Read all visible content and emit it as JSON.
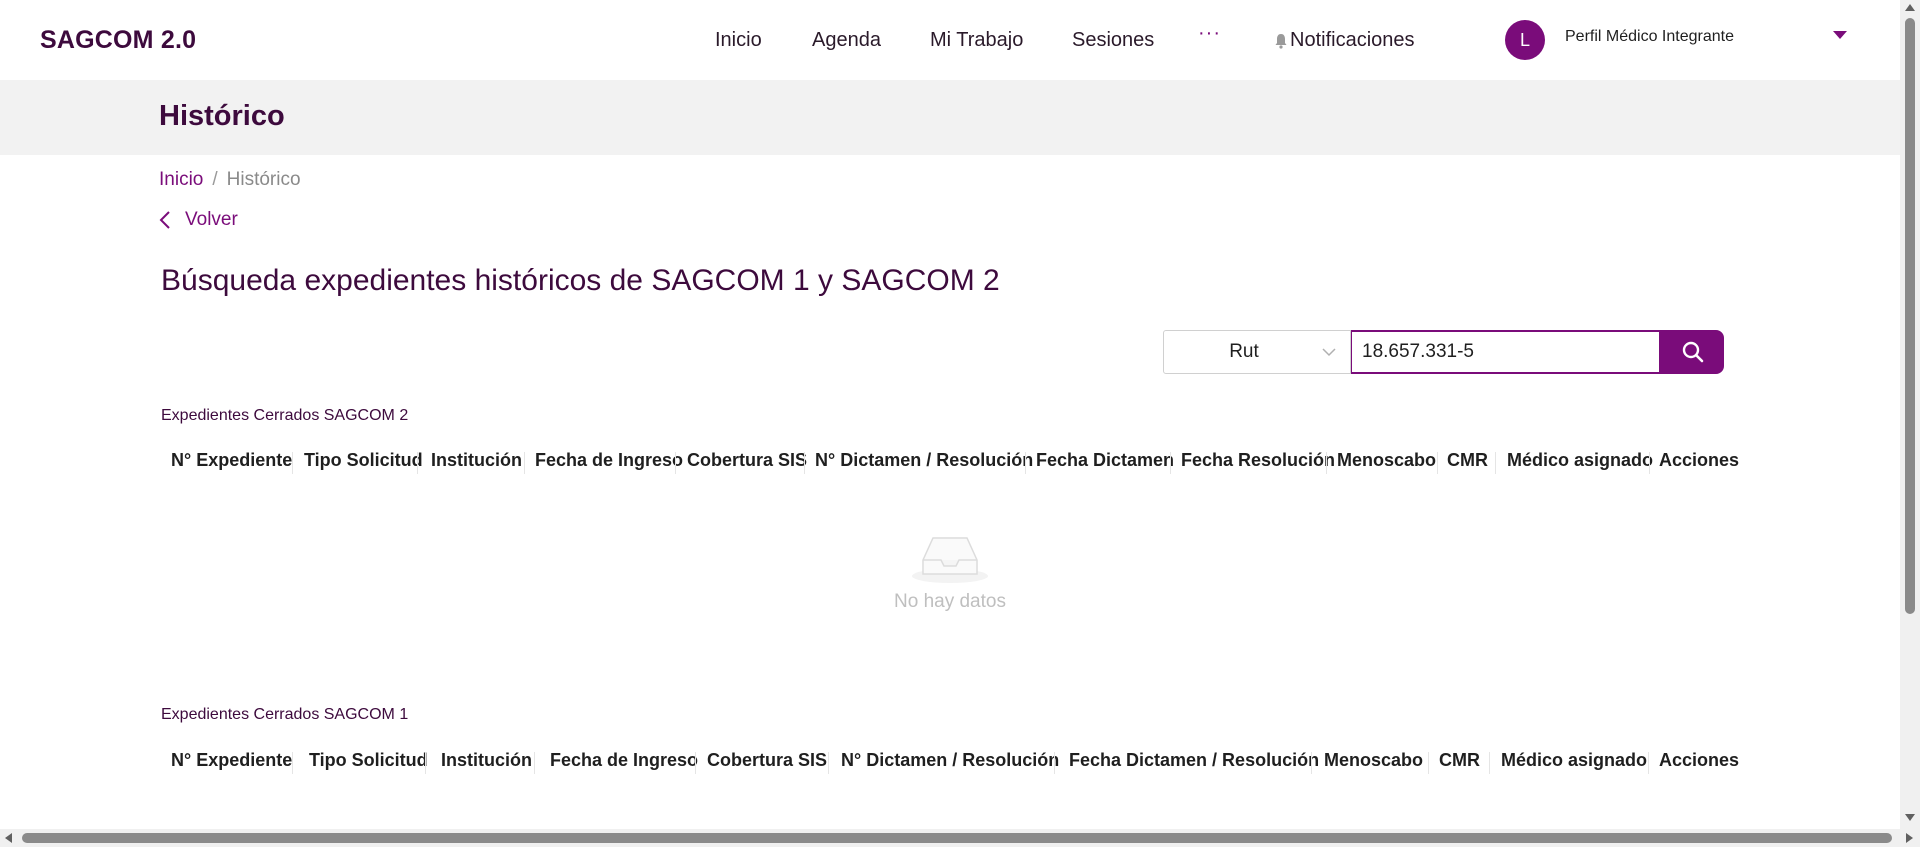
{
  "header": {
    "brand": "SAGCOM 2.0",
    "nav": [
      {
        "label": "Inicio"
      },
      {
        "label": "Agenda"
      },
      {
        "label": "Mi Trabajo"
      },
      {
        "label": "Sesiones"
      }
    ],
    "more_label": "···",
    "notifications_label": "Notificaciones",
    "avatar_initial": "L",
    "profile_name": "Perfil Médico Integrante"
  },
  "page": {
    "band_title": "Histórico",
    "breadcrumb": {
      "home": "Inicio",
      "separator": "/",
      "current": "Histórico"
    },
    "back_label": "Volver",
    "title": "Búsqueda expedientes históricos de SAGCOM 1 y SAGCOM 2"
  },
  "search": {
    "type_selected": "Rut",
    "value": "18.657.331-5"
  },
  "table2": {
    "label": "Expedientes Cerrados SAGCOM 2",
    "columns": [
      "N° Expediente",
      "Tipo Solicitud",
      "Institución",
      "Fecha de Ingreso",
      "Cobertura SIS",
      "N° Dictamen / Resolución",
      "Fecha Dictamen",
      "Fecha Resolución",
      "Menoscabo",
      "CMR",
      "Médico asignado",
      "Acciones"
    ],
    "empty_text": "No hay datos"
  },
  "table1": {
    "label": "Expedientes Cerrados SAGCOM 1",
    "columns": [
      "N° Expediente",
      "Tipo Solicitud",
      "Institución",
      "Fecha de Ingreso",
      "Cobertura SIS",
      "N° Dictamen / Resolución",
      "Fecha Dictamen / Resolución",
      "Menoscabo",
      "CMR",
      "Médico asignado",
      "Acciones"
    ]
  },
  "colors": {
    "primary": "#7a0c7a",
    "heading": "#3d0a3d",
    "band": "#f2f2f2"
  }
}
